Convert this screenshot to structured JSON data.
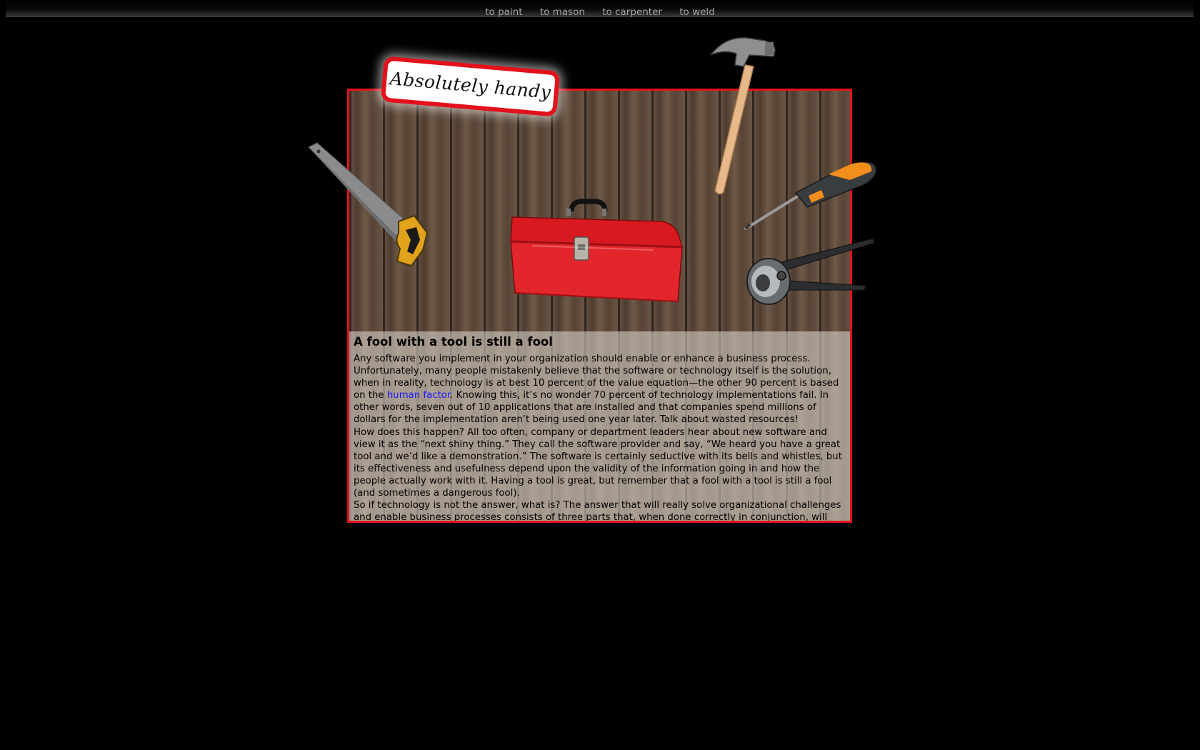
{
  "nav": {
    "items": [
      {
        "label": "to paint"
      },
      {
        "label": "to mason"
      },
      {
        "label": "to carpenter"
      },
      {
        "label": "to weld"
      }
    ]
  },
  "badge": {
    "text": "Absolutely handy"
  },
  "article": {
    "title": "A fool with a tool is still a fool",
    "p1_before_link": "Any software you implement in your organization should enable or enhance a business process. Unfortunately, many people mistakenly believe that the software or technology itself is the solution, when in reality, technology is at best 10 percent of the value equation—the other 90 percent is based on the ",
    "p1_link": "human factor",
    "p1_after_link": ". Knowing this, it’s no wonder 70 percent of technology implementations fail. In other words, seven out of 10 applications that are installed and that companies spend millions of dollars for the implementation aren’t being used one year later. Talk about wasted resources!",
    "p2": "How does this happen? All too often, company or department leaders hear about new software and view it as the “next shiny thing.” They call the software provider and say, “We heard you have a great tool and we’d like a demonstration.” The software is certainly seductive with its bells and whistles, but its effectiveness and usefulness depend upon the validity of the information going in and how the people actually work with it. Having a tool is great, but remember that a fool with a tool is still a fool (and sometimes a dangerous fool).",
    "p3": "So if technology is not the answer, what is? The answer that will really solve organizational challenges and enable business processes consists of three parts that, when done correctly in conjunction, will lead to long lasting results."
  },
  "icons": {
    "saw": "hand-saw-icon",
    "toolbox": "toolbox-icon",
    "hammer": "hammer-icon",
    "screwdriver": "screwdriver-icon",
    "pincers": "pincers-icon"
  },
  "colors": {
    "accent": "#e3111b",
    "background": "#000000",
    "nav_text": "#a6a6a6",
    "link": "#1a1aff"
  }
}
